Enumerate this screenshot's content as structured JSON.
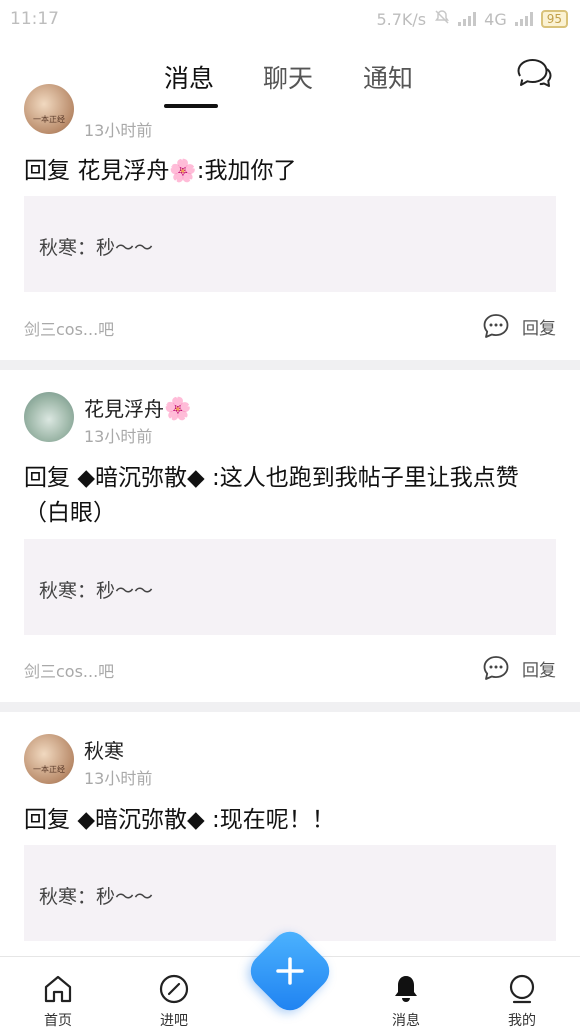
{
  "status_bar": {
    "time": "11:17",
    "network_speed": "5.7K/s",
    "network_type": "4G",
    "battery": "95"
  },
  "top_nav": {
    "tabs": [
      {
        "label": "消息",
        "active": true
      },
      {
        "label": "聊天",
        "active": false
      },
      {
        "label": "通知",
        "active": false
      }
    ]
  },
  "items": [
    {
      "time": "13小时前",
      "reply_prefix": "回复",
      "reply_target": "花見浮舟",
      "reply_body": ":我加你了",
      "quote": "秋寒：秒～～",
      "forum": "剑三cos...吧",
      "reply_label": "回复"
    },
    {
      "name": "花見浮舟",
      "time": "13小时前",
      "reply_prefix": "回复",
      "reply_target": "◆暗沉弥散◆",
      "reply_body": ":这人也跑到我帖子里让我点赞（白眼）",
      "quote": "秋寒：秒～～",
      "forum": "剑三cos...吧",
      "reply_label": "回复"
    },
    {
      "name": "秋寒",
      "time": "13小时前",
      "reply_prefix": "回复",
      "reply_target": "◆暗沉弥散◆",
      "reply_body": ":现在呢！！",
      "quote": "秋寒：秒～～"
    }
  ],
  "avatar_caption": "一本正经",
  "bottom_nav": {
    "home": "首页",
    "enter_bar": "进吧",
    "messages": "消息",
    "mine": "我的"
  },
  "colors": {
    "accent_blue": "#2a8ff7",
    "quote_bg": "#f5f2f6",
    "muted_text": "#a9a9a9"
  }
}
